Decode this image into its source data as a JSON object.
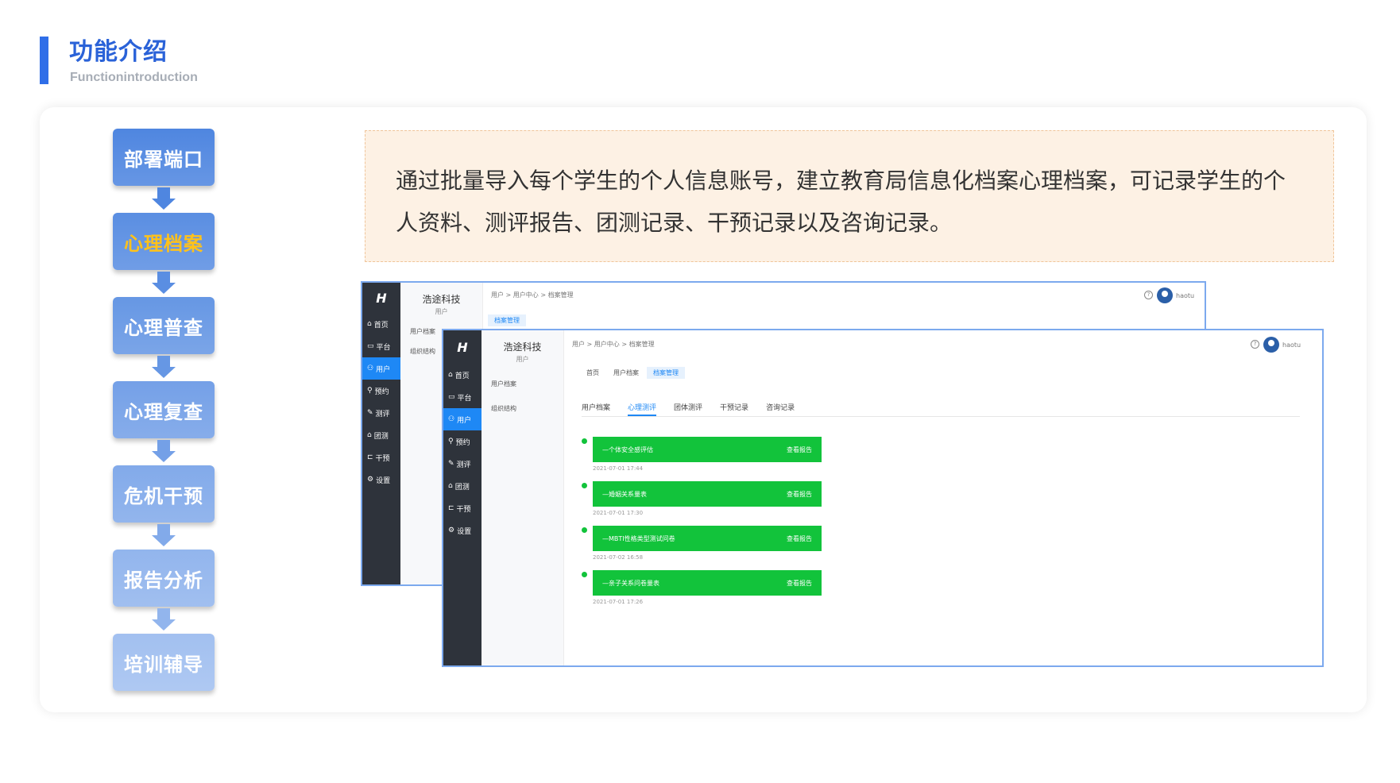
{
  "header": {
    "title": "功能介绍",
    "subtitle": "Functionintroduction"
  },
  "flow": {
    "steps": [
      {
        "label": "部署端口",
        "color": "#4f86e0"
      },
      {
        "label": "心理档案",
        "color": "#5a8ee2"
      },
      {
        "label": "心理普查",
        "color": "#6697e4"
      },
      {
        "label": "心理复查",
        "color": "#74a0e7"
      },
      {
        "label": "危机干预",
        "color": "#82aaea"
      },
      {
        "label": "报告分析",
        "color": "#92b5ed"
      },
      {
        "label": "培训辅导",
        "color": "#a2c0f0"
      }
    ],
    "active_step": "心理档案",
    "active_color": "#ffc21a"
  },
  "description": "通过批量导入每个学生的个人信息账号，建立教育局信息化档案心理档案，可记录学生的个人资料、测评报告、团测记录、干预记录以及咨询记录。",
  "app": {
    "logo": "H",
    "nav": [
      {
        "icon": "home-icon",
        "glyph": "⌂",
        "label": "首页"
      },
      {
        "icon": "platform-icon",
        "glyph": "▭",
        "label": "平台"
      },
      {
        "icon": "user-icon",
        "glyph": "⚇",
        "label": "用户"
      },
      {
        "icon": "booking-icon",
        "glyph": "⚲",
        "label": "预约"
      },
      {
        "icon": "assess-icon",
        "glyph": "✎",
        "label": "测评"
      },
      {
        "icon": "group-icon",
        "glyph": "⌂",
        "label": "团测"
      },
      {
        "icon": "intervene-icon",
        "glyph": "⊏",
        "label": "干预"
      },
      {
        "icon": "settings-icon",
        "glyph": "⚙",
        "label": "设置"
      }
    ],
    "active_nav": "用户",
    "brand": "浩途科技",
    "brand_sub": "用户",
    "sub_menu": [
      "用户档案",
      "组织结构"
    ],
    "breadcrumb": "用户 > 用户中心 > 档案管理",
    "username": "haotu",
    "page_tabs": [
      "首页",
      "用户档案",
      "档案管理"
    ],
    "active_page_tab": "档案管理",
    "record_tabs": [
      "用户档案",
      "心理测评",
      "团体测评",
      "干预记录",
      "咨询记录"
    ],
    "active_record_tab": "心理测评",
    "records": [
      {
        "name": "—个体安全感评估",
        "action": "查看报告",
        "time": "2021-07-01 17:44"
      },
      {
        "name": "—婚姻关系量表",
        "action": "查看报告",
        "time": "2021-07-01 17:30"
      },
      {
        "name": "—MBTI性格类型测试问卷",
        "action": "查看报告",
        "time": "2021-07-02 16:58"
      },
      {
        "name": "—亲子关系问卷量表",
        "action": "查看报告",
        "time": "2021-07-01 17:26"
      }
    ],
    "accent_color": "#1e88f5",
    "record_color": "#12c33b"
  }
}
